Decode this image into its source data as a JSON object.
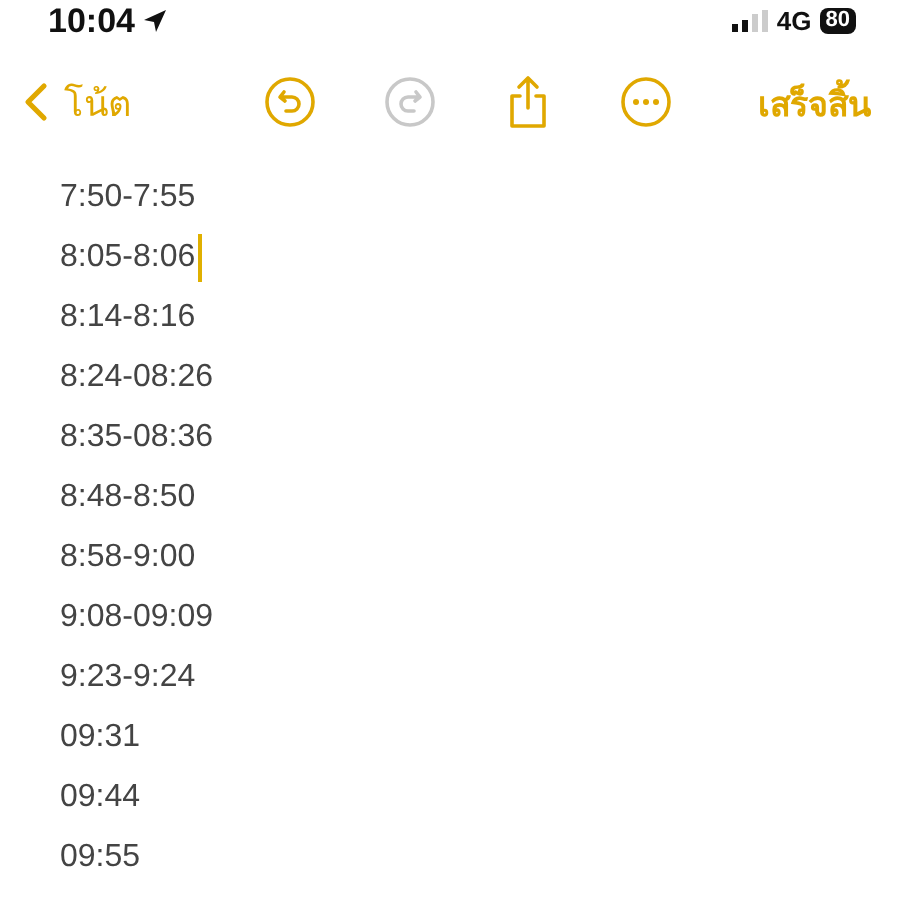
{
  "status_bar": {
    "time": "10:04",
    "network": "4G",
    "battery": "80"
  },
  "nav": {
    "back": "โน้ต",
    "done": "เสร็จสิ้น",
    "tools": [
      {
        "kind": "undo",
        "disabled": false
      },
      {
        "kind": "redo",
        "disabled": true
      },
      {
        "kind": "share",
        "disabled": false
      },
      {
        "kind": "more",
        "disabled": false
      }
    ]
  },
  "lines": [
    {
      "text": "7:50-7:55",
      "cursor": false
    },
    {
      "text": "8:05-8:06",
      "cursor": true
    },
    {
      "text": "8:14-8:16",
      "cursor": false
    },
    {
      "text": "8:24-08:26",
      "cursor": false
    },
    {
      "text": "8:35-08:36",
      "cursor": false
    },
    {
      "text": "8:48-8:50",
      "cursor": false
    },
    {
      "text": "8:58-9:00",
      "cursor": false
    },
    {
      "text": "9:08-09:09",
      "cursor": false
    },
    {
      "text": "9:23-9:24",
      "cursor": false
    },
    {
      "text": "09:31",
      "cursor": false
    },
    {
      "text": "09:44",
      "cursor": false
    },
    {
      "text": "09:55",
      "cursor": false
    }
  ]
}
